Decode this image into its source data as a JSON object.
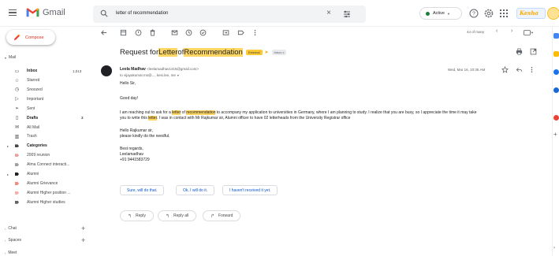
{
  "header": {
    "app_name": "Gmail",
    "search_query": "letter of recommendation",
    "status_label": "Active",
    "status_color": "#188038",
    "brand_badge": "Kesha"
  },
  "compose_label": "Compose",
  "sidebar": {
    "mail_section": "Mail",
    "items": [
      {
        "label": "Inbox",
        "count": "1,013",
        "icon": "inbox-icon",
        "bold": true
      },
      {
        "label": "Starred",
        "count": "",
        "icon": "star-icon"
      },
      {
        "label": "Snoozed",
        "count": "",
        "icon": "clock-icon"
      },
      {
        "label": "Important",
        "count": "",
        "icon": "label-important-icon"
      },
      {
        "label": "Sent",
        "count": "",
        "icon": "send-icon"
      },
      {
        "label": "Drafts",
        "count": "3",
        "icon": "draft-icon",
        "bold": true
      },
      {
        "label": "All Mail",
        "count": "",
        "icon": "all-mail-icon"
      },
      {
        "label": "Trash",
        "count": "",
        "icon": "trash-icon"
      },
      {
        "label": "Categories",
        "count": "",
        "icon": "label-icon",
        "bold": true
      },
      {
        "label": "2009 reunion",
        "count": "",
        "icon": "label-icon",
        "color": "#e8a0a0"
      },
      {
        "label": "Alma Connect interacti...",
        "count": "",
        "icon": "label-icon",
        "color": "#9e9e9e"
      },
      {
        "label": "Alumni",
        "count": "",
        "icon": "label-icon",
        "color": "#202124"
      },
      {
        "label": "Alumni Grievance",
        "count": "",
        "icon": "label-icon",
        "color": "#f28b82"
      },
      {
        "label": "Alumni Higher position ...",
        "count": "",
        "icon": "label-icon",
        "color": "#f6aea9"
      },
      {
        "label": "Alumni Higher studies",
        "count": "",
        "icon": "label-icon",
        "color": "#5f6368"
      }
    ],
    "chat_section": "Chat",
    "spaces_section": "Spaces",
    "meet_section": "Meet"
  },
  "toolbar": {
    "pager_text": "44 of many"
  },
  "message": {
    "subject_before": "Request for ",
    "subject_hl1": "Letter",
    "subject_mid": " of ",
    "subject_hl2": "Recommendation",
    "tag_external": "External",
    "tag_inbox": "Inbox x",
    "sender_name": "Leela Madhav",
    "sender_email": "<leelamadhav1415@gmail.com>",
    "to_line": "to vijayakumar.ms@..., kesi.lee, me",
    "date": "Wed, Mar 16, 10:35 AM",
    "greeting": "Hello Sir,",
    "line_good_day": "Good day!",
    "p1_a": "I am reaching out to ask for a ",
    "p1_hl1": "letter",
    "p1_b": " of ",
    "p1_hl2": "recommendation",
    "p1_c": " to accompany my application to universities in Germany, where I am planning to study. I realize that you are busy, so I appreciate the time it may take",
    "p1_d": "you to write this ",
    "p1_hl3": "letter",
    "p1_e": ". I was in contact with Mr Rajkumar sir, Alumni officer to have 02 letterheads from the University Registrar office",
    "p2_a": "Hello Rajkumar sir,",
    "p2_b": "please kindly do the needful.",
    "sign_1": "Best regards,",
    "sign_2": "Leelamadhav",
    "sign_3": "+91 9441583729"
  },
  "smart_replies": [
    "Sure, will do that.",
    "Ok, I will do it.",
    "I haven't received it yet."
  ],
  "reply_buttons": {
    "reply": "Reply",
    "reply_all": "Reply all",
    "forward": "Forward"
  }
}
